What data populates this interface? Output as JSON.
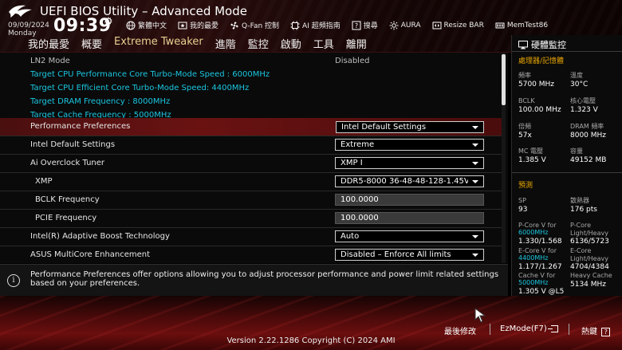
{
  "header": {
    "title": "UEFI BIOS Utility – Advanced Mode",
    "date": "09/09/2024",
    "day": "Monday",
    "time": "09:39",
    "toolbar": [
      {
        "label": "繁體中文",
        "icon": "globe-icon"
      },
      {
        "label": "我的最愛",
        "icon": "favorites-icon"
      },
      {
        "label": "Q-Fan 控制",
        "icon": "fan-icon"
      },
      {
        "label": "AI 超頻指南",
        "icon": "ai-icon"
      },
      {
        "label": "搜尋",
        "icon": "search-help-icon"
      },
      {
        "label": "AURA",
        "icon": "aura-icon"
      },
      {
        "label": "Resize BAR",
        "icon": "resize-bar-icon"
      },
      {
        "label": "MemTest86",
        "icon": "memtest-icon"
      }
    ]
  },
  "tabs": [
    {
      "label": "我的最愛",
      "active": false
    },
    {
      "label": "概要",
      "active": false
    },
    {
      "label": "Extreme Tweaker",
      "active": true
    },
    {
      "label": "進階",
      "active": false
    },
    {
      "label": "監控",
      "active": false
    },
    {
      "label": "啟動",
      "active": false
    },
    {
      "label": "工具",
      "active": false
    },
    {
      "label": "離開",
      "active": false
    }
  ],
  "settings": {
    "ln2": {
      "label": "LN2 Mode",
      "value": "Disabled"
    },
    "info": [
      "Target CPU Performance Core Turbo-Mode Speed : 6000MHz",
      "Target CPU Efficient Core Turbo-Mode Speed: 4400MHz",
      "Target DRAM Frequency : 8000MHz",
      "Target Cache Frequency : 5000MHz"
    ],
    "perf_pref": {
      "label": "Performance Preferences",
      "value": "Intel Default Settings"
    },
    "intel_default": {
      "label": "Intel Default Settings",
      "value": "Extreme"
    },
    "ai_oc": {
      "label": "Ai Overclock Tuner",
      "value": "XMP I"
    },
    "xmp": {
      "label": "XMP",
      "value": "DDR5-8000 36-48-48-128-1.45V"
    },
    "bclk": {
      "label": "BCLK Frequency",
      "value": "100.0000"
    },
    "pcie": {
      "label": "PCIE Frequency",
      "value": "100.0000"
    },
    "abt": {
      "label": "Intel(R) Adaptive Boost Technology",
      "value": "Auto"
    },
    "mce": {
      "label": "ASUS MultiCore Enhancement",
      "value": "Disabled – Enforce All limits"
    }
  },
  "help": {
    "text": "Performance Preferences offer options allowing you to adjust processor performance and power limit related settings based on your preferences."
  },
  "hw_monitor": {
    "title": "硬體監控",
    "section_cpu": "處理器/記憶體",
    "freq_label": "頻率",
    "freq_value": "5700 MHz",
    "temp_label": "溫度",
    "temp_value": "30°C",
    "bclk_label": "BCLK",
    "bclk_value": "100.00 MHz",
    "vcore_label": "核心電壓",
    "vcore_value": "1.323 V",
    "ratio_label": "倍頻",
    "ratio_value": "57x",
    "dram_label": "DRAM 頻率",
    "dram_value": "8000 MHz",
    "mc_label": "MC 電壓",
    "mc_value": "1.385 V",
    "cap_label": "容量",
    "cap_value": "49152 MB",
    "section_pred": "預測",
    "sp_label": "SP",
    "sp_value": "93",
    "heat_label": "散熱器",
    "heat_value": "176 pts",
    "pcore_v_label": "P-Core V for",
    "pcore_v_freq": "6000MHz",
    "pcore_v_value": "1.330/1.568",
    "pcore_lh_label": "P-Core Light/Heavy",
    "pcore_lh_value": "6136/5723",
    "ecore_v_label": "E-Core V for",
    "ecore_v_freq": "4400MHz",
    "ecore_v_value": "1.177/1.267",
    "ecore_lh_label": "E-Core Light/Heavy",
    "ecore_lh_value": "4704/4384",
    "cache_v_label": "Cache V for",
    "cache_v_freq": "5000MHz",
    "cache_v_value": "1.305 V @L5",
    "heavy_cache_label": "Heavy Cache",
    "heavy_cache_value": "5134 MHz"
  },
  "footer": {
    "last_modified": "最後修改",
    "ezmode": "EzMode(F7)",
    "hotkeys": "熱鍵",
    "version": "Version 2.22.1286 Copyright (C) 2024 AMI"
  },
  "colors": {
    "accent_red": "#6a1212",
    "cyan": "#1ac6e0",
    "gold": "#e8c15a",
    "orange": "#e6a400"
  }
}
